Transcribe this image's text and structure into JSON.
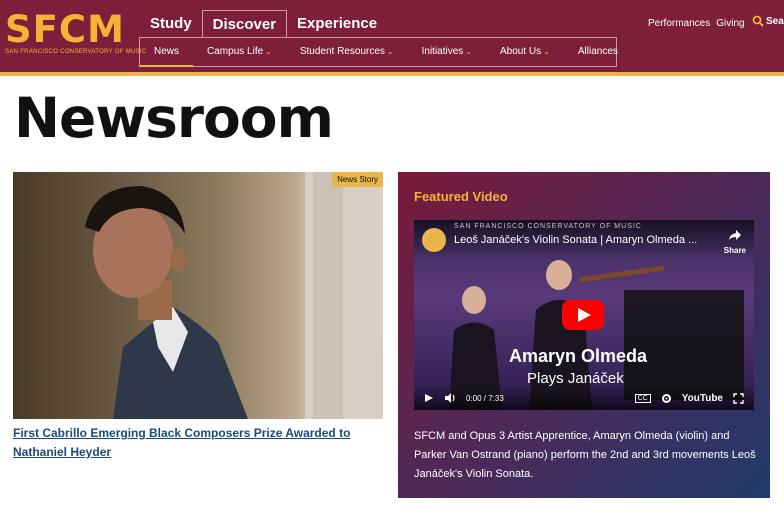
{
  "logo": {
    "text": "SFCM",
    "subtitle": "SAN FRANCISCO CONSERVATORY OF MUSIC"
  },
  "primary_nav": [
    {
      "label": "Study",
      "active": false
    },
    {
      "label": "Discover",
      "active": true
    },
    {
      "label": "Experience",
      "active": false
    }
  ],
  "secondary_nav": [
    {
      "label": "News",
      "dropdown": false,
      "active": true
    },
    {
      "label": "Campus Life",
      "dropdown": true,
      "active": false
    },
    {
      "label": "Student Resources",
      "dropdown": true,
      "active": false
    },
    {
      "label": "Initiatives",
      "dropdown": true,
      "active": false
    },
    {
      "label": "About Us",
      "dropdown": true,
      "active": false
    },
    {
      "label": "Alliances",
      "dropdown": false,
      "active": false
    }
  ],
  "utility_links": [
    "Performances",
    "Giving"
  ],
  "search": {
    "label": "Sea"
  },
  "page_title": "Newsroom",
  "news": {
    "badge": "News Story",
    "headline": "First Cabrillo Emerging Black Composers Prize Awarded to Nathaniel Heyder"
  },
  "featured": {
    "title": "Featured Video",
    "video": {
      "channel_text": "SAN FRANCISCO CONSERVATORY OF MUSIC",
      "title": "Leoš Janáček's Violin Sonata | Amaryn Olmeda ...",
      "share_label": "Share",
      "overlay_name": "Amaryn Olmeda",
      "overlay_sub": "Plays Janáček",
      "time": "0:00 / 7:33",
      "brand": "YouTube",
      "cc_label": "CC"
    },
    "description": "SFCM and Opus 3 Artist Apprentice, Amaryn Olmeda (violin) and Parker Van Ostrand (piano) perform the 2nd and 3rd movements Leoš Janáček's Violin Sonata."
  },
  "colors": {
    "brand": "#7d1f3a",
    "accent": "#e8b64a",
    "link": "#1b4a7a",
    "youtube_red": "#ff0000"
  }
}
